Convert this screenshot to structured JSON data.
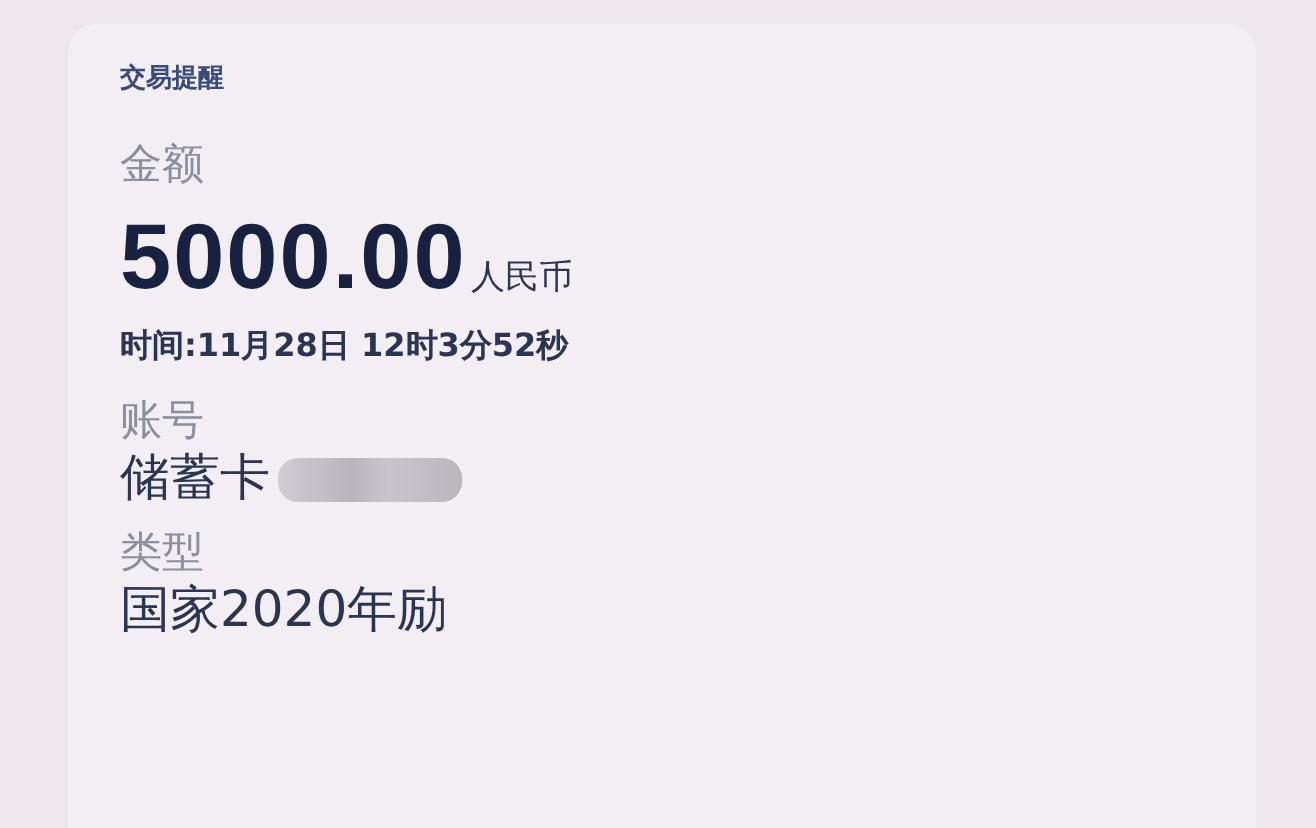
{
  "card": {
    "title": "交易提醒",
    "amount_label": "金额",
    "amount": "5000.00",
    "currency": "人民币",
    "time": "时间:11月28日 12时3分52秒",
    "account_label": "账号",
    "account": "储蓄卡",
    "account_redacted": true,
    "type_label": "类型",
    "type": "国家2020年励"
  }
}
